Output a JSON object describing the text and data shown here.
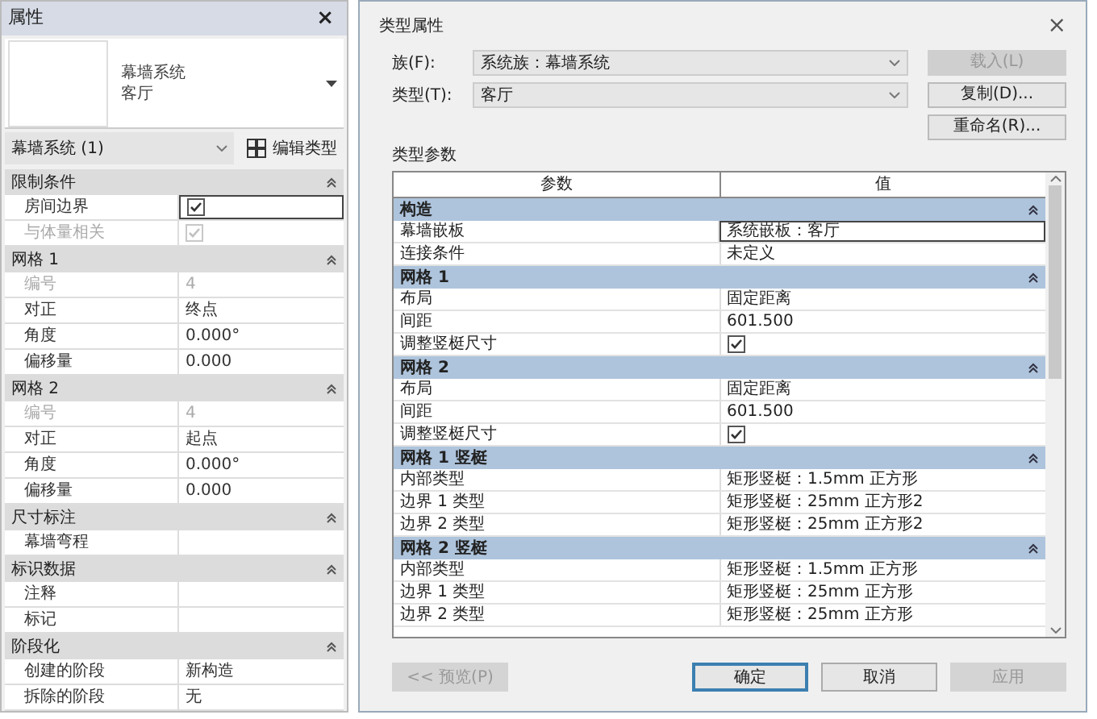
{
  "properties": {
    "title": "属性",
    "close": "×",
    "family_lines": [
      "幕墙系统",
      "客厅"
    ],
    "selector": "幕墙系统 (1)",
    "edit_type": "编辑类型",
    "sections": [
      {
        "title": "限制条件",
        "rows": [
          {
            "label": "房间边界",
            "kind": "checkbox",
            "checked": true,
            "disabled": false,
            "focused": true
          },
          {
            "label": "与体量相关",
            "kind": "checkbox",
            "checked": true,
            "disabled": true,
            "focused": false
          }
        ]
      },
      {
        "title": "网格 1",
        "rows": [
          {
            "label": "编号",
            "kind": "text",
            "value": "4",
            "disabled": true,
            "focused": false
          },
          {
            "label": "对正",
            "kind": "text",
            "value": "终点",
            "disabled": false,
            "focused": false
          },
          {
            "label": "角度",
            "kind": "text",
            "value": "0.000°",
            "disabled": false,
            "focused": false
          },
          {
            "label": "偏移量",
            "kind": "text",
            "value": "0.000",
            "disabled": false,
            "focused": false
          }
        ]
      },
      {
        "title": "网格 2",
        "rows": [
          {
            "label": "编号",
            "kind": "text",
            "value": "4",
            "disabled": true,
            "focused": false
          },
          {
            "label": "对正",
            "kind": "text",
            "value": "起点",
            "disabled": false,
            "focused": false
          },
          {
            "label": "角度",
            "kind": "text",
            "value": "0.000°",
            "disabled": false,
            "focused": false
          },
          {
            "label": "偏移量",
            "kind": "text",
            "value": "0.000",
            "disabled": false,
            "focused": false
          }
        ]
      },
      {
        "title": "尺寸标注",
        "rows": [
          {
            "label": "幕墙弯程",
            "kind": "text",
            "disabled": false,
            "focused": false
          }
        ]
      },
      {
        "title": "标识数据",
        "rows": [
          {
            "label": "注释",
            "kind": "text",
            "disabled": false,
            "focused": false
          },
          {
            "label": "标记",
            "kind": "text",
            "disabled": false,
            "focused": false
          }
        ]
      },
      {
        "title": "阶段化",
        "rows": [
          {
            "label": "创建的阶段",
            "kind": "text",
            "value": "新构造",
            "disabled": false,
            "focused": false
          },
          {
            "label": "拆除的阶段",
            "kind": "text",
            "value": "无",
            "disabled": false,
            "focused": false
          }
        ]
      }
    ]
  },
  "dialog": {
    "title": "类型属性",
    "close": "×",
    "family_label": "族(F):",
    "family_value": "系统族：幕墙系统",
    "type_label": "类型(T):",
    "type_value": "客厅",
    "side_buttons": [
      {
        "label": "载入(L)",
        "disabled": true
      },
      {
        "label": "复制(D)...",
        "disabled": false
      },
      {
        "label": "重命名(R)...",
        "disabled": false
      }
    ],
    "params_label": "类型参数",
    "columns": [
      "参数",
      "值"
    ],
    "sections": [
      {
        "title": "构造",
        "rows": [
          {
            "label": "幕墙嵌板",
            "kind": "text",
            "value": "系统嵌板：客厅",
            "focused": true
          },
          {
            "label": "连接条件",
            "kind": "text",
            "value": "未定义",
            "focused": false
          }
        ]
      },
      {
        "title": "网格 1",
        "rows": [
          {
            "label": "布局",
            "kind": "text",
            "value": "固定距离",
            "focused": false
          },
          {
            "label": "间距",
            "kind": "text",
            "value": "601.500",
            "focused": false
          },
          {
            "label": "调整竖梃尺寸",
            "kind": "checkbox",
            "checked": true,
            "focused": false
          }
        ]
      },
      {
        "title": "网格 2",
        "rows": [
          {
            "label": "布局",
            "kind": "text",
            "value": "固定距离",
            "focused": false
          },
          {
            "label": "间距",
            "kind": "text",
            "value": "601.500",
            "focused": false
          },
          {
            "label": "调整竖梃尺寸",
            "kind": "checkbox",
            "checked": true,
            "focused": false
          }
        ]
      },
      {
        "title": "网格 1 竖梃",
        "rows": [
          {
            "label": "内部类型",
            "kind": "text",
            "value": "矩形竖梃：1.5mm 正方形",
            "focused": false
          },
          {
            "label": "边界 1 类型",
            "kind": "text",
            "value": "矩形竖梃：25mm 正方形2",
            "focused": false
          },
          {
            "label": "边界 2 类型",
            "kind": "text",
            "value": "矩形竖梃：25mm 正方形2",
            "focused": false
          }
        ]
      },
      {
        "title": "网格 2 竖梃",
        "rows": [
          {
            "label": "内部类型",
            "kind": "text",
            "value": "矩形竖梃：1.5mm 正方形",
            "focused": false
          },
          {
            "label": "边界 1 类型",
            "kind": "text",
            "value": "矩形竖梃：25mm 正方形",
            "focused": false
          },
          {
            "label": "边界 2 类型",
            "kind": "text",
            "value": "矩形竖梃：25mm 正方形",
            "focused": false
          }
        ]
      }
    ],
    "buttons": [
      {
        "label": "<< 预览(P)",
        "disabled": true,
        "default": false
      },
      {
        "label": "确定",
        "disabled": false,
        "default": true
      },
      {
        "label": "取消",
        "disabled": false,
        "default": false
      },
      {
        "label": "应用",
        "disabled": true,
        "default": false
      }
    ]
  }
}
